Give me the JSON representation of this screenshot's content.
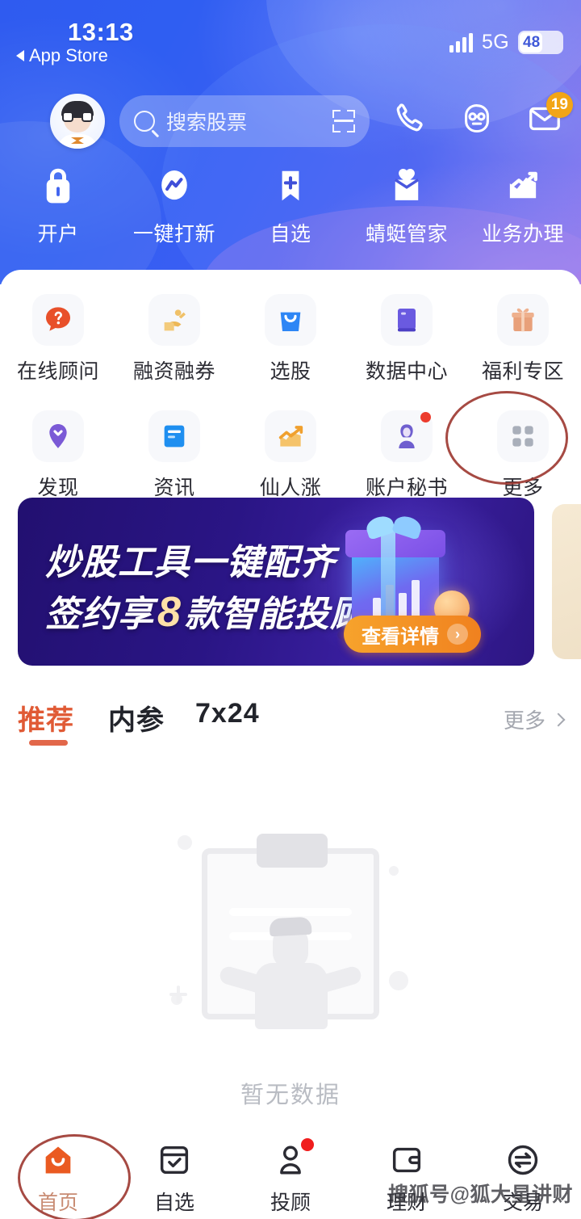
{
  "status_bar": {
    "time": "13:13",
    "back_label": "App Store",
    "network": "5G",
    "battery": "48",
    "signal_icon": "signal-bars-icon"
  },
  "header": {
    "avatar_icon": "user-avatar",
    "search": {
      "placeholder": "搜索股票",
      "search_icon": "search-icon",
      "scan_icon": "scan-icon"
    },
    "icons": [
      {
        "name": "phone-icon",
        "badge": ""
      },
      {
        "name": "customer-service-face-icon",
        "badge": ""
      },
      {
        "name": "mail-icon",
        "badge": "19"
      }
    ],
    "quick_nav": [
      {
        "label": "开户",
        "icon": "lock-icon"
      },
      {
        "label": "一键打新",
        "icon": "chart-oval-icon"
      },
      {
        "label": "自选",
        "icon": "bookmark-plus-icon"
      },
      {
        "label": "蜻蜓管家",
        "icon": "heart-box-icon"
      },
      {
        "label": "业务办理",
        "icon": "trend-up-icon"
      }
    ]
  },
  "grid": {
    "row1": [
      {
        "label": "在线顾问",
        "icon": "question-bubble-icon",
        "color": "#e8502a",
        "dot": false
      },
      {
        "label": "融资融券",
        "icon": "hand-money-icon",
        "color": "#f0bc50",
        "dot": false
      },
      {
        "label": "选股",
        "icon": "shopping-bag-icon",
        "color": "#2e86f5",
        "dot": false
      },
      {
        "label": "数据中心",
        "icon": "book-data-icon",
        "color": "#6a5ae0",
        "dot": false
      },
      {
        "label": "福利专区",
        "icon": "gift-icon",
        "color": "#e8906a",
        "dot": false
      }
    ],
    "row2": [
      {
        "label": "发现",
        "icon": "location-pin-icon",
        "color": "#7b5ad6",
        "dot": false
      },
      {
        "label": "资讯",
        "icon": "news-book-icon",
        "color": "#1f8ff0",
        "dot": false
      },
      {
        "label": "仙人涨",
        "icon": "orange-chart-icon",
        "color": "#f0b84a",
        "dot": false
      },
      {
        "label": "账户秘书",
        "icon": "secretary-person-icon",
        "color": "#6f5fcf",
        "dot": true
      },
      {
        "label": "更多",
        "icon": "grid-dots-icon",
        "color": "#aab0bb",
        "dot": false
      }
    ]
  },
  "banner": {
    "line1": "炒股工具一键配齐",
    "line2_prefix": "签约享",
    "line2_number": "8",
    "line2_suffix": "款智能投顾",
    "cta_label": "查看详情",
    "cta_arrow": "›",
    "gift_icon": "gift-box-illustration"
  },
  "tabs": {
    "items": [
      {
        "label": "推荐",
        "active": true
      },
      {
        "label": "内参",
        "active": false
      },
      {
        "label": "7x24",
        "active": false
      }
    ],
    "more_label": "更多",
    "more_icon": "chevron-right-icon"
  },
  "empty_state": {
    "text": "暂无数据",
    "illustration_icon": "no-data-clipboard-illustration"
  },
  "bottom_nav": [
    {
      "label": "首页",
      "icon": "home-icon",
      "active": true,
      "dot": false
    },
    {
      "label": "自选",
      "icon": "checkbox-list-icon",
      "active": false,
      "dot": false
    },
    {
      "label": "投顾",
      "icon": "advisor-person-icon",
      "active": false,
      "dot": true
    },
    {
      "label": "理财",
      "icon": "wallet-icon",
      "active": false,
      "dot": false
    },
    {
      "label": "交易",
      "icon": "exchange-icon",
      "active": false,
      "dot": false
    }
  ],
  "annotations": {
    "circle_more": "red-circle-highlight-more",
    "circle_home": "red-circle-highlight-home"
  },
  "watermark": "搜狐号@狐大星讲财",
  "colors": {
    "header_blue": "#3358f0",
    "accent_orange": "#e05a35",
    "badge_orange": "#f2a516",
    "annotation_red": "#9e3b33"
  }
}
